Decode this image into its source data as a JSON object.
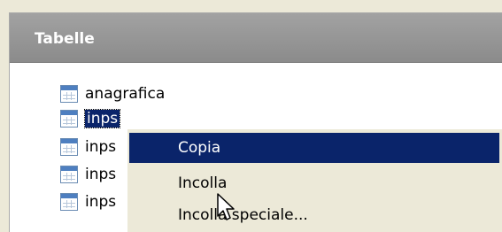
{
  "panel": {
    "title": "Tabelle"
  },
  "tree": {
    "items": [
      {
        "label": "anagrafica",
        "icon": "table-icon",
        "selected": false
      },
      {
        "label": "inps",
        "icon": "table-icon",
        "selected": true
      },
      {
        "label": "inps",
        "icon": "table-icon",
        "selected": false
      },
      {
        "label": "inps",
        "icon": "table-icon",
        "selected": false
      },
      {
        "label": "inps",
        "icon": "table-icon",
        "selected": false
      }
    ]
  },
  "context_menu": {
    "items": [
      {
        "label": "Copia",
        "highlighted": true
      },
      {
        "label": "Incolla",
        "highlighted": false
      },
      {
        "label": "Incolla speciale...",
        "highlighted": false
      }
    ]
  },
  "colors": {
    "header_bg": "#959595",
    "selection_bg": "#0a246a",
    "menu_bg": "#ece9d8"
  }
}
